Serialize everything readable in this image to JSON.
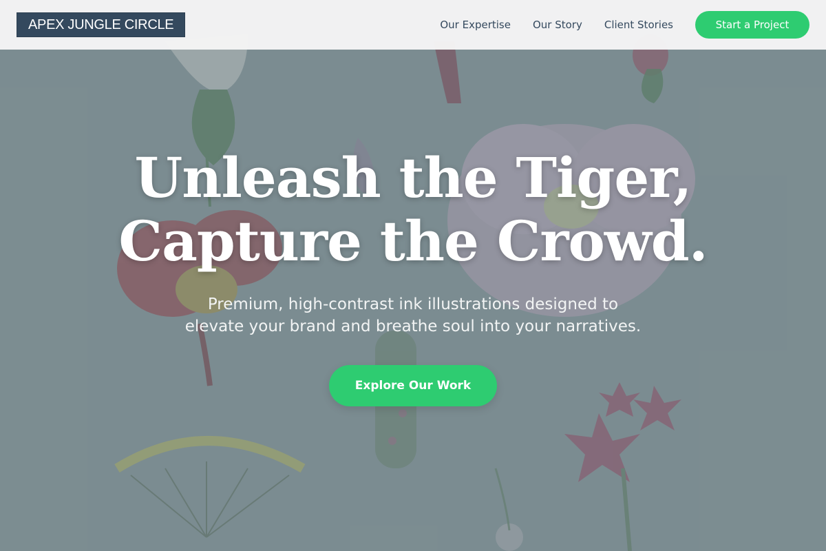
{
  "header": {
    "logo_text": "APEX JUNGLE CIRCLE",
    "nav": [
      {
        "label": "Our Expertise"
      },
      {
        "label": "Our Story"
      },
      {
        "label": "Client Stories"
      }
    ],
    "cta_label": "Start a Project"
  },
  "hero": {
    "title_line1": "Unleash the Tiger,",
    "title_line2": "Capture the Crowd.",
    "subtitle_line1": "Premium, high-contrast ink illustrations designed to",
    "subtitle_line2": "elevate your brand and breathe soul into your narratives.",
    "cta_label": "Explore Our Work"
  },
  "colors": {
    "accent": "#2ecc71",
    "logo_bg": "#34495e",
    "nav_text": "#34495e"
  },
  "icons": {
    "background": "botanical-illustration"
  }
}
